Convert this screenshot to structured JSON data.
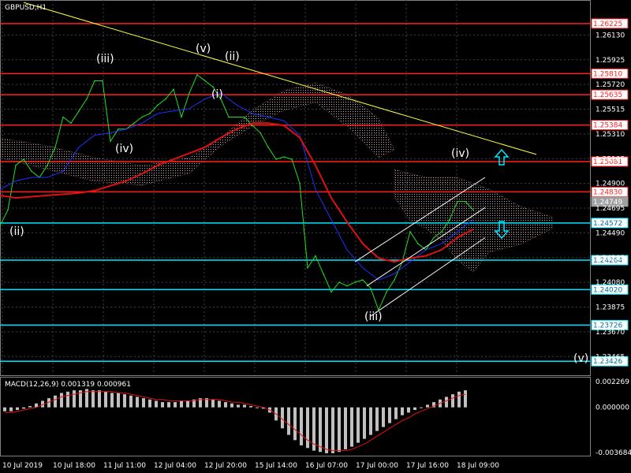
{
  "chart_data": [
    {
      "type": "line",
      "title": "GBPUSD,H1",
      "ylim": [
        1.2331,
        1.2642
      ],
      "price_ticks": [
        "1.26130",
        "1.25925",
        "1.25720",
        "1.25515",
        "1.25310",
        "1.25105",
        "1.24900",
        "1.24695",
        "1.24490",
        "1.24285",
        "1.24080",
        "1.23875",
        "1.23670",
        "1.23465"
      ],
      "x_ticks": [
        "10 Jul 2019",
        "10 Jul 18:00",
        "11 Jul 11:00",
        "12 Jul 04:00",
        "12 Jul 20:00",
        "15 Jul 14:00",
        "16 Jul 07:00",
        "17 Jul 00:00",
        "17 Jul 16:00",
        "18 Jul 09:00"
      ],
      "levels": [
        {
          "value": 1.26225,
          "label": "1.26225",
          "color": "#ff2020",
          "box": "#ff2020"
        },
        {
          "value": 1.2581,
          "label": "1.25810",
          "color": "#ff2020",
          "box": "#ff2020"
        },
        {
          "value": 1.25635,
          "label": "1.25635",
          "color": "#ff2020",
          "box": "#ff2020"
        },
        {
          "value": 1.25384,
          "label": "1.25384",
          "color": "#ff2020",
          "box": "#ff2020"
        },
        {
          "value": 1.25081,
          "label": "1.25081",
          "color": "#ff2020",
          "box": "#ff2020"
        },
        {
          "value": 1.2483,
          "label": "1.24830",
          "color": "#ff2020",
          "box": "#ff2020"
        },
        {
          "value": 1.24749,
          "label": "1.24749",
          "color": "#ffffff",
          "box": "#a0a0a0",
          "current": true
        },
        {
          "value": 1.24572,
          "label": "1.24572",
          "color": "#00e5ff",
          "box": "#00e5ff"
        },
        {
          "value": 1.24264,
          "label": "1.24264",
          "color": "#00e5ff",
          "box": "#00e5ff"
        },
        {
          "value": 1.2402,
          "label": "1.24020",
          "color": "#00e5ff",
          "box": "#00e5ff"
        },
        {
          "value": 1.23726,
          "label": "1.23726",
          "color": "#00e5ff",
          "box": "#00e5ff"
        },
        {
          "value": 1.23426,
          "label": "1.23426",
          "color": "#00e5ff",
          "box": "#00e5ff"
        }
      ],
      "wave_labels": [
        "(ii)",
        "(iii)",
        "(iv)",
        "(v)",
        "(i)",
        "(ii)",
        "(iii)",
        "(iv)",
        "(v)"
      ],
      "series": [
        {
          "name": "price",
          "color": "#20e020",
          "x": [
            0,
            10,
            20,
            30,
            40,
            50,
            60,
            70,
            80,
            90,
            100,
            110,
            120,
            130,
            140,
            150,
            160,
            170,
            180,
            190,
            200,
            210,
            220,
            230,
            240,
            250,
            260,
            270,
            280,
            290,
            300,
            310,
            320,
            330,
            340,
            350,
            360,
            370,
            380,
            390,
            400,
            410,
            420,
            430,
            440,
            450,
            460,
            470,
            480,
            490,
            500,
            510,
            520,
            530,
            540,
            550,
            560,
            570,
            580,
            590,
            600
          ],
          "values": [
            1.2455,
            1.2468,
            1.2505,
            1.251,
            1.25,
            1.2495,
            1.2505,
            1.252,
            1.2545,
            1.254,
            1.255,
            1.256,
            1.2575,
            1.2575,
            1.2525,
            1.2535,
            1.2535,
            1.254,
            1.2545,
            1.2548,
            1.2555,
            1.256,
            1.2568,
            1.2545,
            1.2565,
            1.258,
            1.2575,
            1.257,
            1.256,
            1.2545,
            1.2545,
            1.2545,
            1.2538,
            1.2532,
            1.252,
            1.251,
            1.2512,
            1.251,
            1.249,
            1.242,
            1.243,
            1.2415,
            1.24,
            1.2408,
            1.2405,
            1.2408,
            1.241,
            1.2403,
            1.2385,
            1.24,
            1.241,
            1.2425,
            1.245,
            1.244,
            1.2435,
            1.2445,
            1.245,
            1.246,
            1.2475,
            1.2475,
            1.2468
          ]
        },
        {
          "name": "fast-average",
          "color": "#2030ff",
          "x": [
            0,
            20,
            40,
            60,
            80,
            100,
            120,
            140,
            160,
            180,
            200,
            220,
            240,
            260,
            280,
            300,
            320,
            340,
            360,
            380,
            400,
            420,
            440,
            460,
            480,
            500,
            520,
            540,
            560,
            580,
            600
          ],
          "values": [
            1.2485,
            1.2492,
            1.2495,
            1.2495,
            1.25,
            1.252,
            1.253,
            1.2532,
            1.2535,
            1.254,
            1.2548,
            1.255,
            1.2552,
            1.256,
            1.2565,
            1.2555,
            1.2548,
            1.2545,
            1.2542,
            1.253,
            1.2485,
            1.246,
            1.2435,
            1.242,
            1.241,
            1.2415,
            1.2425,
            1.2435,
            1.244,
            1.245,
            1.246
          ]
        },
        {
          "name": "slow-average",
          "color": "#e01010",
          "x": [
            0,
            20,
            40,
            60,
            80,
            100,
            120,
            140,
            160,
            180,
            200,
            220,
            240,
            260,
            280,
            300,
            320,
            340,
            360,
            380,
            400,
            420,
            440,
            460,
            480,
            500,
            520,
            540,
            560,
            580,
            600
          ],
          "values": [
            1.248,
            1.2478,
            1.2479,
            1.248,
            1.2481,
            1.2482,
            1.2484,
            1.2488,
            1.2492,
            1.2498,
            1.2505,
            1.251,
            1.2515,
            1.252,
            1.2528,
            1.2535,
            1.254,
            1.254,
            1.2538,
            1.2528,
            1.2505,
            1.2478,
            1.2458,
            1.244,
            1.2428,
            1.2425,
            1.2428,
            1.243,
            1.2435,
            1.2445,
            1.2452
          ]
        },
        {
          "name": "yellow-line",
          "color": "#ffff40",
          "x": [
            30,
            680
          ],
          "values": [
            1.264,
            1.2514
          ]
        },
        {
          "name": "channel-top",
          "color": "#ffffff",
          "x": [
            450,
            615
          ],
          "values": [
            1.2425,
            1.2495
          ]
        },
        {
          "name": "channel-mid",
          "color": "#ffffff",
          "x": [
            465,
            615
          ],
          "values": [
            1.2405,
            1.247
          ]
        },
        {
          "name": "channel-bottom",
          "color": "#ffffff",
          "x": [
            470,
            615
          ],
          "values": [
            1.238,
            1.2445
          ]
        }
      ]
    },
    {
      "type": "bar",
      "title": "MACD(12,26,9) 0.001319 0.000961",
      "ylim": [
        -0.003684,
        0.002269
      ],
      "y_ticks": [
        "0.002269",
        "0.000000",
        "-0.003684"
      ],
      "series": [
        {
          "name": "histogram",
          "color": "#c0c0c0",
          "values": [
            -0.0003,
            -0.0003,
            -0.0002,
            -0.0001,
            0.0001,
            0.0003,
            0.0005,
            0.0007,
            0.0009,
            0.0011,
            0.0012,
            0.0013,
            0.0013,
            0.0014,
            0.0013,
            0.0013,
            0.0012,
            0.0011,
            0.0011,
            0.001,
            0.0009,
            0.0008,
            0.0007,
            0.0006,
            0.0005,
            0.0004,
            0.0004,
            0.0004,
            0.0005,
            0.0005,
            0.0006,
            0.0007,
            0.0007,
            0.0006,
            0.0005,
            0.0004,
            0.0003,
            0.0002,
            0.0002,
            0.0001,
            0.0,
            -0.0001,
            -0.0004,
            -0.001,
            -0.0016,
            -0.0021,
            -0.0025,
            -0.0029,
            -0.0031,
            -0.0033,
            -0.0034,
            -0.0035,
            -0.0035,
            -0.0034,
            -0.0032,
            -0.003,
            -0.0027,
            -0.0024,
            -0.0021,
            -0.0018,
            -0.0015,
            -0.0012,
            -0.0009,
            -0.0006,
            -0.0004,
            -0.0002,
            0.0,
            0.0002,
            0.0004,
            0.0006,
            0.0008,
            0.001,
            0.0012,
            0.0013
          ]
        },
        {
          "name": "signal",
          "color": "#e01010",
          "values": [
            -0.0004,
            -0.0004,
            -0.0003,
            -0.0002,
            -0.0001,
            0.0,
            0.0002,
            0.0004,
            0.0006,
            0.0008,
            0.0009,
            0.001,
            0.0011,
            0.0012,
            0.0012,
            0.0012,
            0.0012,
            0.0012,
            0.0011,
            0.0011,
            0.001,
            0.0009,
            0.0008,
            0.0007,
            0.0006,
            0.0006,
            0.0005,
            0.0005,
            0.0005,
            0.0005,
            0.0005,
            0.0006,
            0.0006,
            0.0006,
            0.0006,
            0.0005,
            0.0004,
            0.0004,
            0.0003,
            0.0002,
            0.0001,
            0.0,
            -0.0002,
            -0.0005,
            -0.0009,
            -0.0013,
            -0.0017,
            -0.0021,
            -0.0025,
            -0.0028,
            -0.003,
            -0.0032,
            -0.0033,
            -0.0033,
            -0.0033,
            -0.0032,
            -0.003,
            -0.0028,
            -0.0025,
            -0.0022,
            -0.0019,
            -0.0016,
            -0.0013,
            -0.001,
            -0.0008,
            -0.0005,
            -0.0003,
            -0.0001,
            0.0001,
            0.0003,
            0.0005,
            0.0007,
            0.0009,
            0.001
          ]
        }
      ]
    }
  ]
}
